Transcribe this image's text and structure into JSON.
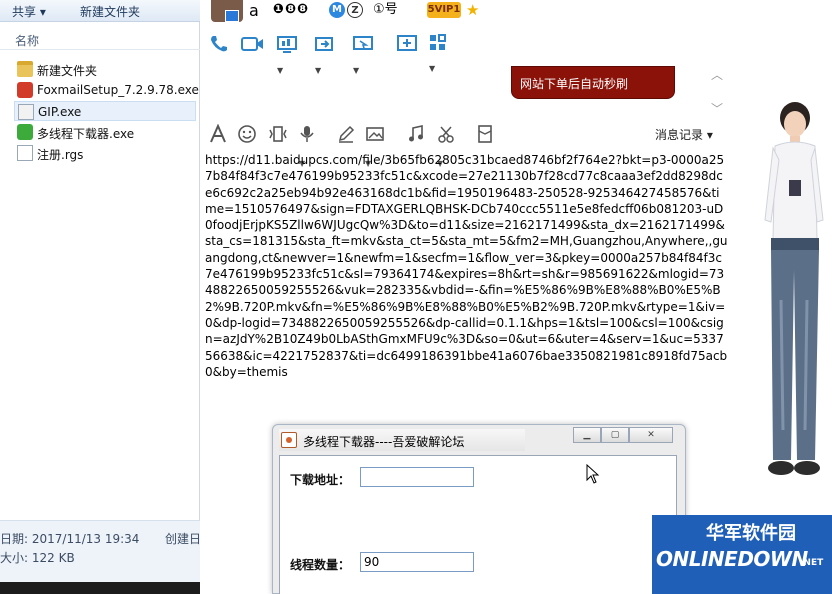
{
  "explorer": {
    "toolbar": {
      "share": "共享 ▾",
      "new_folder": "新建文件夹"
    },
    "column_name": "名称",
    "files": [
      {
        "name": "新建文件夹",
        "icon": "folder-icon"
      },
      {
        "name": "FoxmailSetup_7.2.9.78.exe",
        "icon": "foxmail-icon"
      },
      {
        "name": "GIP.exe",
        "icon": "exe-icon",
        "selected": true
      },
      {
        "name": "多线程下载器.exe",
        "icon": "green-app-icon"
      },
      {
        "name": "注册.rgs",
        "icon": "document-icon"
      }
    ],
    "details": {
      "date": "日期: 2017/11/13 19:34",
      "created": "创建日",
      "size": "大小: 122 KB"
    }
  },
  "chat": {
    "contact_name": "a",
    "badge_nums": "❶❽❽",
    "badge_m": "M",
    "badge_z": "Z",
    "badge_hao": "①号",
    "badge_svip": "5VIP1",
    "badge_star": "★",
    "promo_text": "网站下单后自动秒刷",
    "message_history": "消息记录 ▾",
    "message": "https://d11.baidupcs.com/file/3b65fb62805c31bcaed8746bf2f764e2?bkt=p3-0000a257b84f84f3c7e476199b95233fc51c&xcode=27e21130b7f28cd77c8caaa3ef2dd8298dce6c692c2a25eb94b92e463168dc1b&fid=1950196483-250528-925346427458576&time=1510576497&sign=FDTAXGERLQBHSK-DCb740ccc5511e5e8fedcff06b081203-uD0foodjErjpKS5Zllw6WJUgcQw%3D&to=d11&size=2162171499&sta_dx=2162171499&sta_cs=181315&sta_ft=mkv&sta_ct=5&sta_mt=5&fm2=MH,Guangzhou,Anywhere,,guangdong,ct&newver=1&newfm=1&secfm=1&flow_ver=3&pkey=0000a257b84f84f3c7e476199b95233fc51c&sl=79364174&expires=8h&rt=sh&r=985691622&mlogid=7348822650059255526&vuk=282335&vbdid=-&fin=%E5%86%9B%E8%88%B0%E5%B2%9B.720P.mkv&fn=%E5%86%9B%E8%88%B0%E5%B2%9B.720P.mkv&rtype=1&iv=0&dp-logid=7348822650059255526&dp-callid=0.1.1&hps=1&tsl=100&csl=100&csign=azJdY%2B10Z49b0LbASthGmxMFU9c%3D&so=0&ut=6&uter=4&serv=1&uc=533756638&ic=4221752837&ti=dc6499186391bbe41a6076bae3350821981c8918fd75acb0&by=themis"
  },
  "dialog": {
    "title": "多线程下载器----吾爱破解论坛",
    "url_label": "下载地址：",
    "url_value": "",
    "thread_label": "线程数量：",
    "thread_value": "90"
  },
  "watermark": {
    "cn": "华军软件园",
    "en": "ONLINEDOWN",
    "net": ".NET"
  },
  "colors": {
    "accent": "#2d84c8",
    "promo": "#8a1208",
    "watermark": "#1f5fb8"
  }
}
